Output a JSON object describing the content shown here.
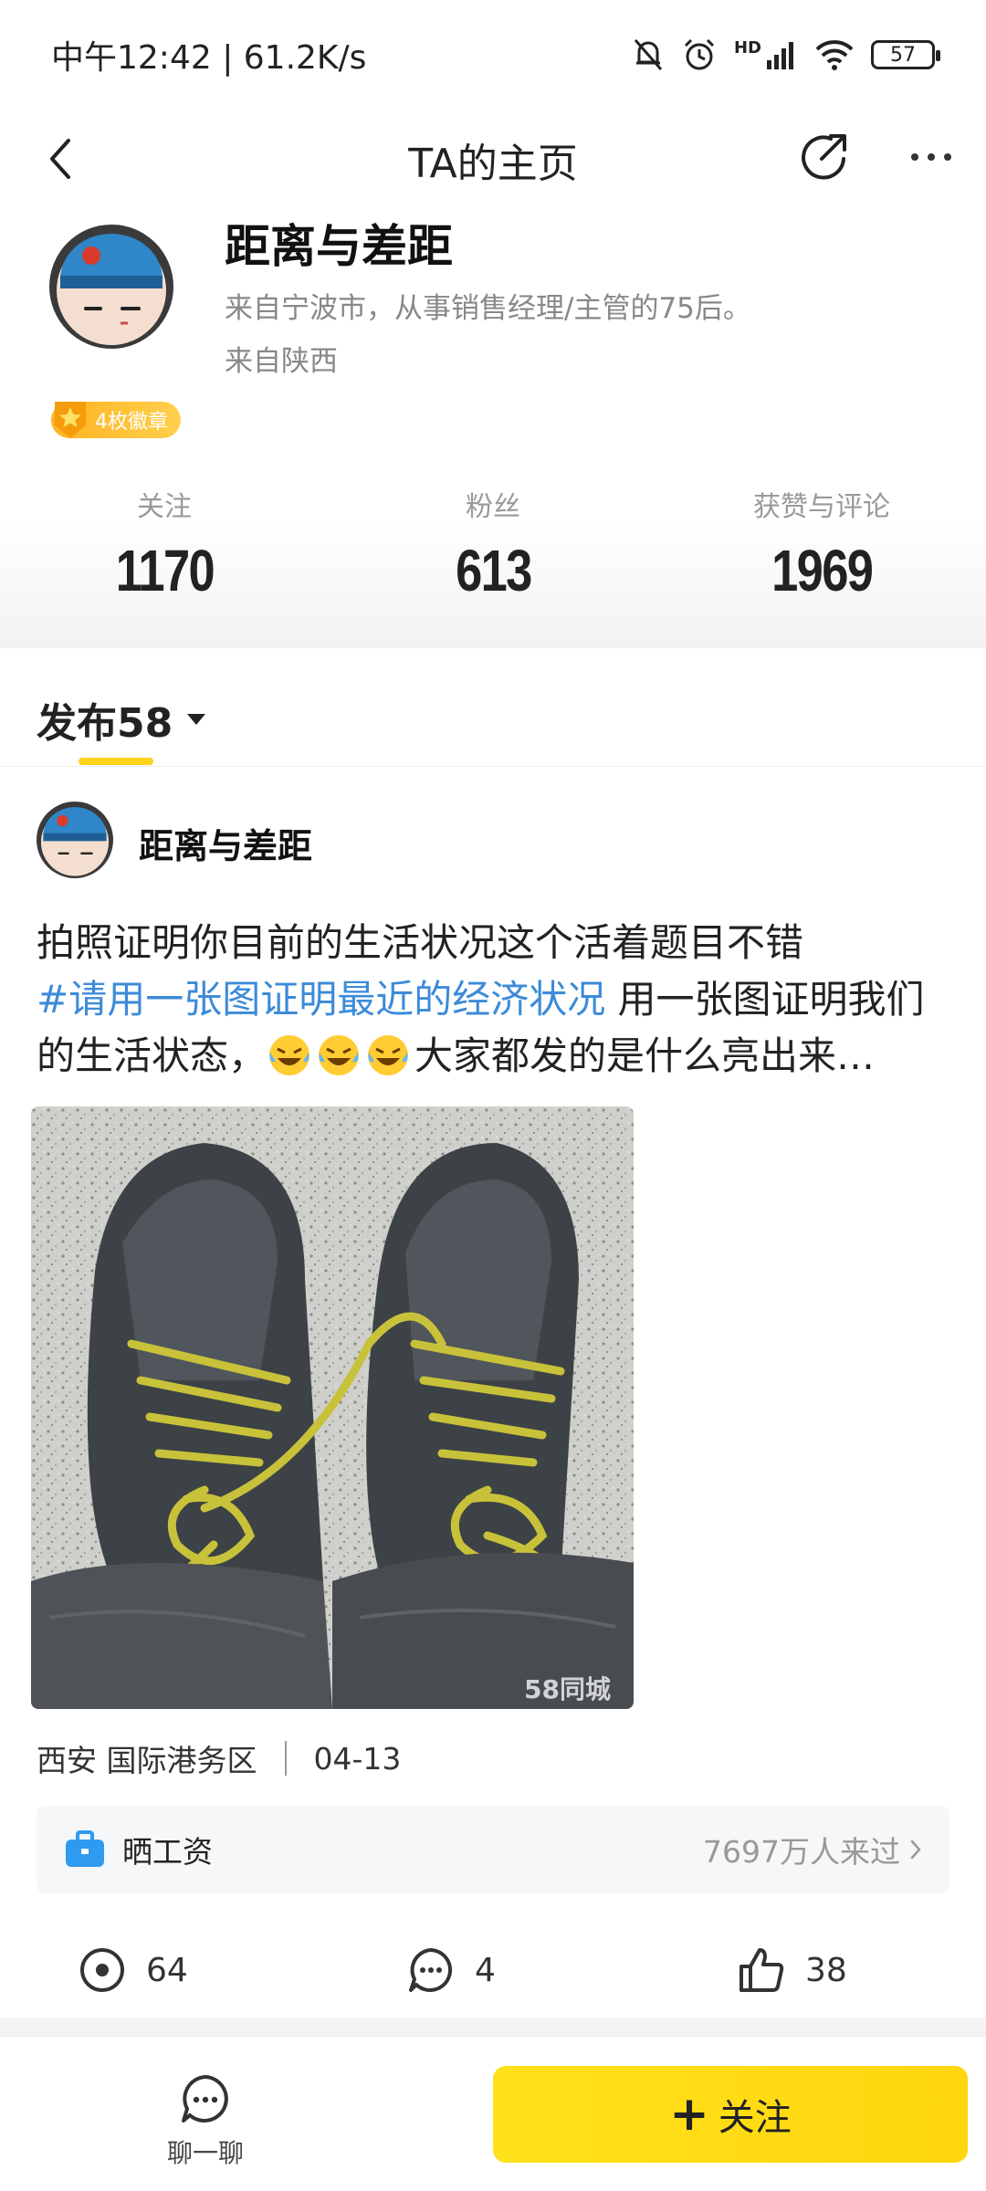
{
  "status_bar": {
    "time_speed": "中午12:42 | 61.2K/s",
    "battery": "57",
    "signal_label": "HD"
  },
  "header": {
    "title": "TA的主页"
  },
  "profile": {
    "username": "距离与差距",
    "bio": "来自宁波市，从事销售经理/主管的75后。",
    "origin": "来自陕西",
    "badge": "4枚徽章"
  },
  "stats": [
    {
      "label": "关注",
      "value": "1170"
    },
    {
      "label": "粉丝",
      "value": "613"
    },
    {
      "label": "获赞与评论",
      "value": "1969"
    }
  ],
  "tab": {
    "label": "发布58"
  },
  "post": {
    "author": "距离与差距",
    "text_part1": "拍照证明你目前的生活状况这个活着题目不错",
    "hashtag": "#请用一张图证明最近的经济状况",
    "text_part2": " 用一张图证明我们的生活状态，",
    "text_part3": "大家都发的是什么亮出来…",
    "watermark": "58同城",
    "location": "西安 国际港务区",
    "date": "04-13",
    "topic_name": "晒工资",
    "topic_visits": "7697万人来过",
    "views": "64",
    "comments": "4",
    "likes": "38"
  },
  "bottom_bar": {
    "chat_label": "聊一聊",
    "follow_label": "关注"
  },
  "colors": {
    "accent_yellow": "#ffd60e",
    "hashtag_blue": "#3c8bd9",
    "badge_orange": "#ffb320"
  }
}
